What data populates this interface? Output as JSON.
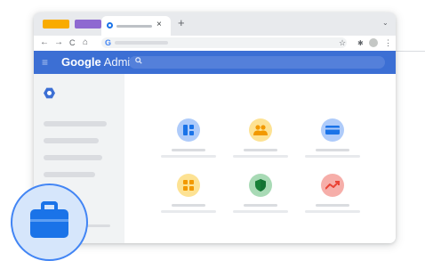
{
  "browser": {
    "tab_colors": [
      "#f9ab00",
      "#8e69d1"
    ],
    "active_tab": {
      "favicon": "google-admin-favicon",
      "close_glyph": "×"
    },
    "new_tab_glyph": "+",
    "tab_menu_glyph": "⌄",
    "nav": {
      "back": "←",
      "forward": "→",
      "reload": "C",
      "home": "⌂"
    },
    "omnibox": {
      "site_icon": "G"
    },
    "bookmark_glyph": "☆",
    "extensions_glyph": "✱",
    "menu_glyph": "⋮"
  },
  "admin": {
    "menu_glyph": "≡",
    "brand_google": "Google",
    "brand_product": "Admin",
    "search_icon": "search-icon",
    "accent": "#3c6fd4"
  },
  "cards": [
    {
      "name": "dashboard",
      "icon": "dashboard-icon",
      "bg": "#aecbfa",
      "fg": "#1a73e8"
    },
    {
      "name": "users",
      "icon": "users-icon",
      "bg": "#fde293",
      "fg": "#f29900"
    },
    {
      "name": "billing",
      "icon": "billing-card-icon",
      "bg": "#aecbfa",
      "fg": "#1a73e8"
    },
    {
      "name": "apps",
      "icon": "apps-grid-icon",
      "bg": "#fde293",
      "fg": "#f29900"
    },
    {
      "name": "security",
      "icon": "security-shield-icon",
      "bg": "#a8dab5",
      "fg": "#188038"
    },
    {
      "name": "reports",
      "icon": "reports-trend-icon",
      "bg": "#f6aea9",
      "fg": "#ea4335"
    }
  ],
  "badge": {
    "icon": "briefcase-icon",
    "color": "#1a73e8"
  }
}
